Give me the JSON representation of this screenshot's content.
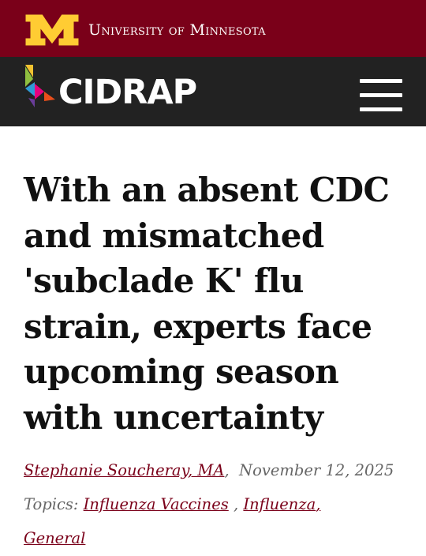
{
  "header": {
    "university_name": "University of Minnesota",
    "brand_color": "#7a0019",
    "nav_bg": "#222222",
    "logo_color": "#ffcc33"
  },
  "nav": {
    "site_name": "CIDRAP",
    "menu_icon": "hamburger-menu-icon"
  },
  "article": {
    "title": "With an absent CDC and mismatched 'subclade K' flu strain, experts face upcoming season with uncertainty",
    "author": "Stephanie Soucheray, MA",
    "date": "November 12, 2025",
    "topics_label": "Topics:",
    "topics": [
      "Influenza Vaccines",
      "Influenza",
      "General"
    ]
  }
}
